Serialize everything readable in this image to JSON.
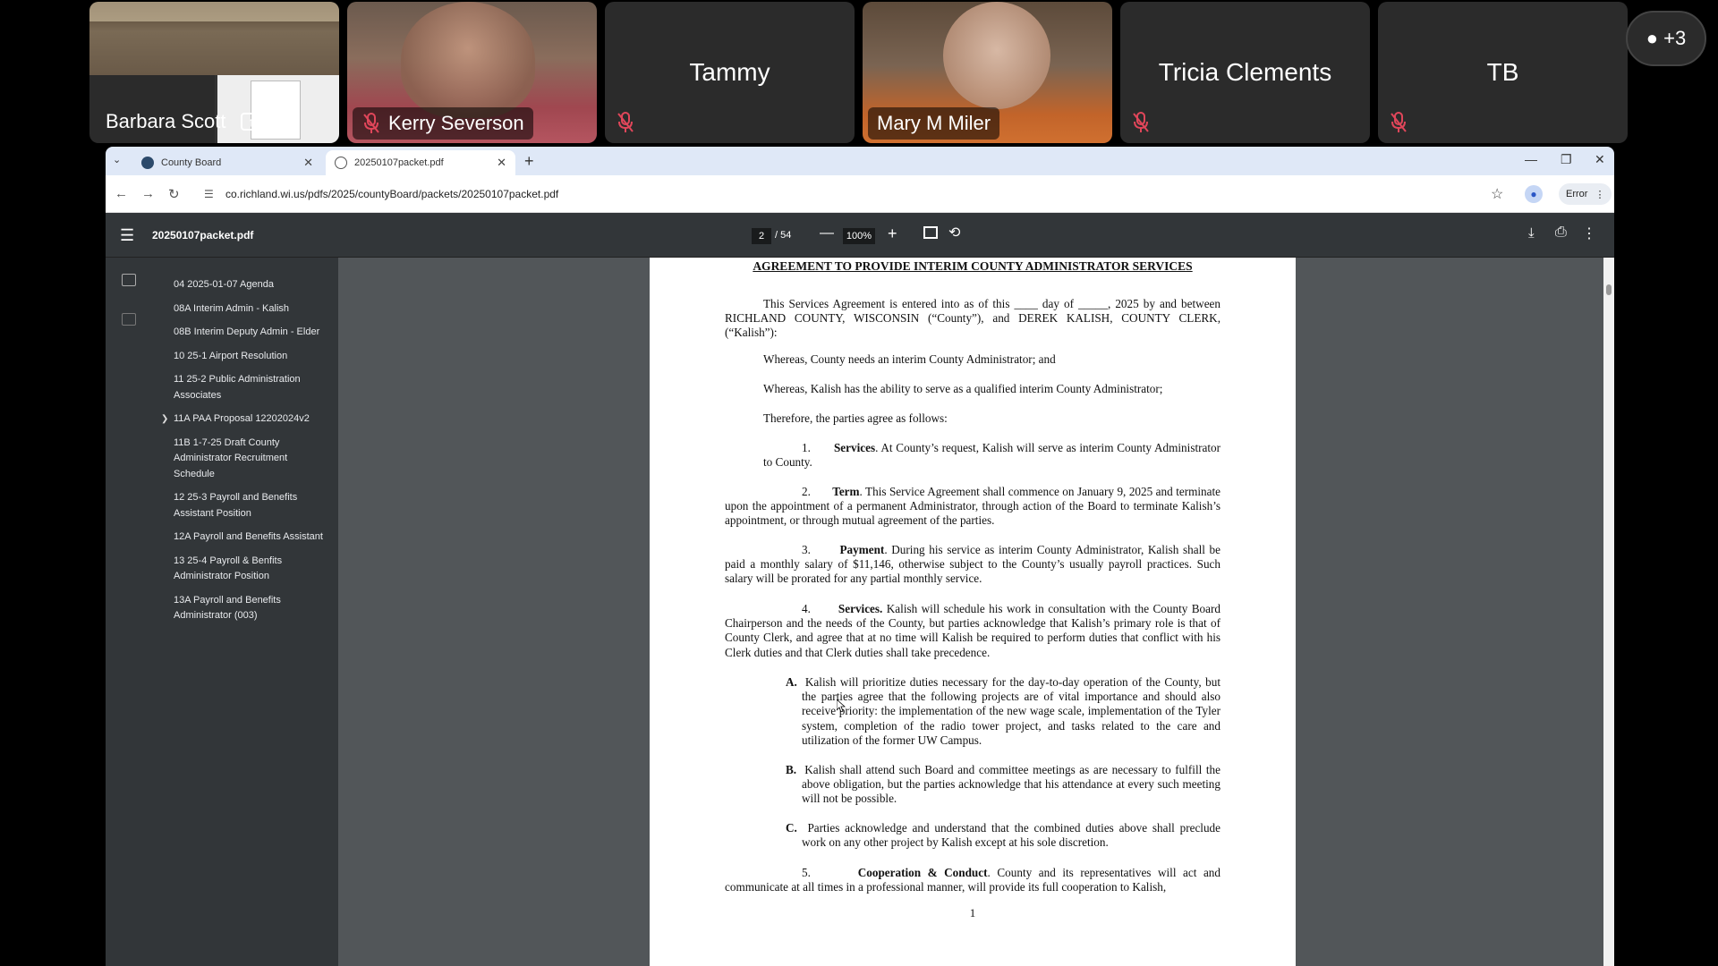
{
  "participants": [
    {
      "name": "Barbara Scott",
      "presenting": true
    },
    {
      "name": "Kerry Severson",
      "muted": true
    },
    {
      "name": "Tammy",
      "muted": true
    },
    {
      "name": "Mary M Miler",
      "muted": false
    },
    {
      "name": "Tricia Clements",
      "muted": true
    },
    {
      "name": "TB",
      "muted": true
    }
  ],
  "more_participants": "+3",
  "browser": {
    "tabs": [
      {
        "label": "County Board",
        "active": false
      },
      {
        "label": "20250107packet.pdf",
        "active": true
      }
    ],
    "url": "co.richland.wi.us/pdfs/2025/countyBoard/packets/20250107packet.pdf",
    "error_label": "Error"
  },
  "pdf": {
    "title": "20250107packet.pdf",
    "page_current": "2",
    "page_total": "/ 54",
    "zoom": "100%",
    "bookmarks": [
      "04 2025-01-07 Agenda",
      "08A Interim Admin - Kalish",
      "08B Interim Deputy Admin - Elder",
      "10 25-1 Airport Resolution",
      "11 25-2 Public Administration Associates",
      "11A PAA Proposal 12202024v2",
      "11B 1-7-25 Draft County Administrator Recruitment Schedule",
      "12 25-3 Payroll and Benefits Assistant Position",
      "12A Payroll and Benefits Assistant",
      "13 25-4 Payroll & Benfits Administrator Position",
      "13A Payroll and Benefits Administrator (003)"
    ]
  },
  "document": {
    "title": "AGREEMENT TO PROVIDE INTERIM COUNTY ADMINISTRATOR SERVICES",
    "intro": "This Services Agreement is entered into as of this ____ day of _____, 2025 by and between RICHLAND COUNTY, WISCONSIN (“County”), and DEREK KALISH, COUNTY CLERK, (“Kalish”):",
    "whereas1": "Whereas, County needs an interim County Administrator; and",
    "whereas2": "Whereas, Kalish has the ability to serve as a qualified interim County Administrator;",
    "therefore": "Therefore, the parties agree as follows:",
    "s1_num": "1.",
    "s1_head": "Services",
    "s1_text": ". At County’s request, Kalish will serve as interim County Administrator to County.",
    "s2_num": "2.",
    "s2_head": "Term",
    "s2_text": ". This Service Agreement shall commence on January 9, 2025 and terminate upon the appointment of a permanent Administrator, through action of the Board to terminate Kalish’s appointment, or through mutual agreement of the parties.",
    "s3_num": "3.",
    "s3_head": "Payment",
    "s3_text": ". During his service as interim County Administrator, Kalish shall be paid a monthly salary of $11,146, otherwise subject to the County’s usually payroll practices. Such salary will be prorated for any partial monthly service.",
    "s4_num": "4.",
    "s4_head": "Services.",
    "s4_text": " Kalish will schedule his work in consultation with the County Board Chairperson and the needs of the County, but parties acknowledge that Kalish’s primary role is that of County Clerk, and agree that at no time will Kalish be required to perform duties that conflict with his Clerk duties and that Clerk duties shall take precedence.",
    "a_num": "A.",
    "a_text": "Kalish will prioritize duties necessary for the day-to-day operation of the County, but the parties agree that the following projects are of vital importance and should also receive priority: the implementation of the new wage scale, implementation of the Tyler system, completion of the radio tower project, and tasks related to the care and utilization of the former UW Campus.",
    "b_num": "B.",
    "b_text": "Kalish shall attend such Board and committee meetings as are necessary to fulfill the above obligation, but the parties acknowledge that his attendance at every such meeting will not be possible.",
    "c_num": "C.",
    "c_text": "Parties acknowledge and understand that the combined duties above shall preclude work on any other project by Kalish except at his sole discretion.",
    "s5_num": "5.",
    "s5_head": "Cooperation & Conduct",
    "s5_text": ". County and its representatives will act and communicate at all times in a professional manner, will provide its full cooperation to Kalish,",
    "page_number": "1"
  }
}
